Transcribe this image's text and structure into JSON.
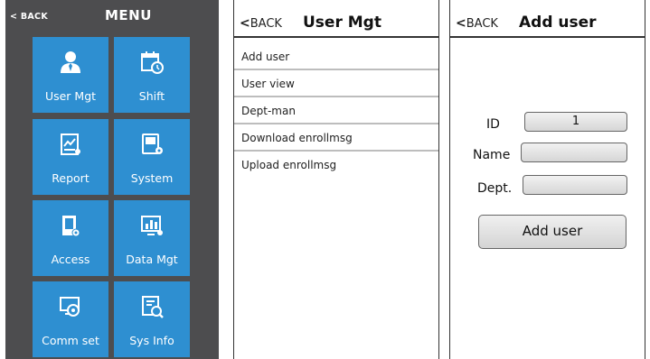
{
  "menu_screen": {
    "back": "< BACK",
    "title": "MENU",
    "tiles": [
      {
        "label": "User Mgt",
        "icon": "users-icon"
      },
      {
        "label": "Shift",
        "icon": "calendar-clock-icon"
      },
      {
        "label": "Report",
        "icon": "report-icon"
      },
      {
        "label": "System",
        "icon": "system-icon"
      },
      {
        "label": "Access",
        "icon": "access-icon"
      },
      {
        "label": "Data Mgt",
        "icon": "data-chart-icon"
      },
      {
        "label": "Comm set",
        "icon": "comm-settings-icon"
      },
      {
        "label": "Sys Info",
        "icon": "sys-info-icon"
      }
    ],
    "tile_color": "#2e8fd1",
    "background_color": "#4d4d4f"
  },
  "user_mgt_screen": {
    "back_arrow": "<",
    "back": "BACK",
    "title": "User Mgt",
    "items": [
      "Add user",
      "User view",
      "Dept-man",
      "Download enrollmsg",
      "Upload enrollmsg"
    ]
  },
  "add_user_screen": {
    "back_arrow": "<",
    "back": "BACK",
    "title": "Add user",
    "fields": {
      "id_label": "ID",
      "id_value": "1",
      "name_label": "Name",
      "name_value": "",
      "dept_label": "Dept.",
      "dept_value": ""
    },
    "submit_label": "Add user"
  }
}
